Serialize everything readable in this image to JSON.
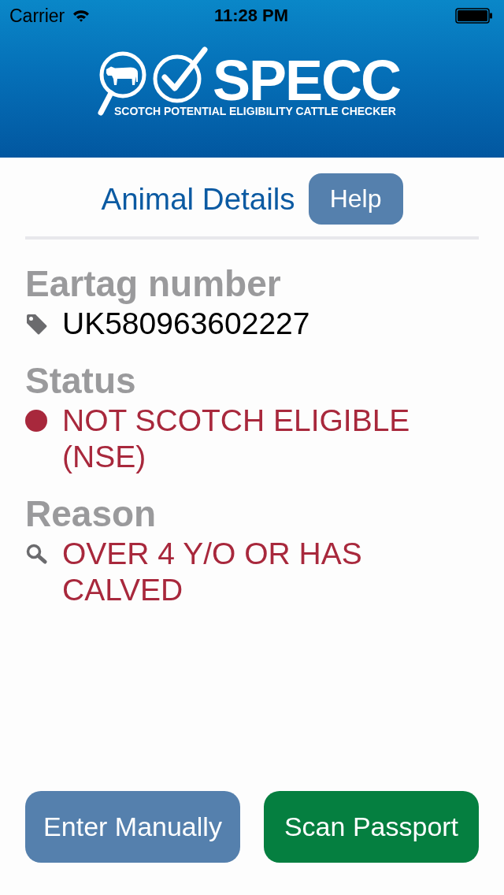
{
  "status_bar": {
    "carrier": "Carrier",
    "time": "11:28 PM"
  },
  "header": {
    "logo_title": "SPECC",
    "logo_subtitle": "SCOTCH POTENTIAL ELIGIBILITY CATTLE CHECKER"
  },
  "page": {
    "title": "Animal Details",
    "help_button": "Help"
  },
  "fields": [
    {
      "kind": "eartag",
      "label": "Eartag number",
      "value": "UK580963602227"
    },
    {
      "kind": "status",
      "label": "Status",
      "value": "NOT SCOTCH ELIGIBLE (NSE)",
      "color": "#a8283c"
    },
    {
      "kind": "reason",
      "label": "Reason",
      "value": "OVER 4 Y/O OR HAS CALVED",
      "color": "#a8283c"
    }
  ],
  "buttons": [
    {
      "kind": "secondary",
      "label": "Enter Manually"
    },
    {
      "kind": "primary",
      "label": "Scan Passport"
    }
  ]
}
